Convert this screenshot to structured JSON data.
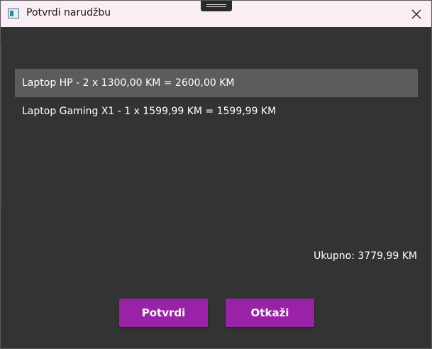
{
  "window": {
    "title": "Potvrdi narudžbu",
    "icon": "window-app-icon",
    "close_icon": "close-icon"
  },
  "order": {
    "items": [
      {
        "label": "Laptop HP - 2 x 1300,00 KM = 2600,00 KM",
        "selected": true
      },
      {
        "label": "Laptop Gaming X1 - 1 x 1599,99 KM = 1599,99 KM",
        "selected": false
      }
    ],
    "total_label": "Ukupno: 3779,99 KM"
  },
  "actions": {
    "confirm_label": "Potvrdi",
    "cancel_label": "Otkaži"
  },
  "colors": {
    "background": "#333333",
    "titlebar": "#f8eef4",
    "selected_item": "#5c5c5c",
    "accent_button": "#9a22a8",
    "text": "#ffffff"
  }
}
